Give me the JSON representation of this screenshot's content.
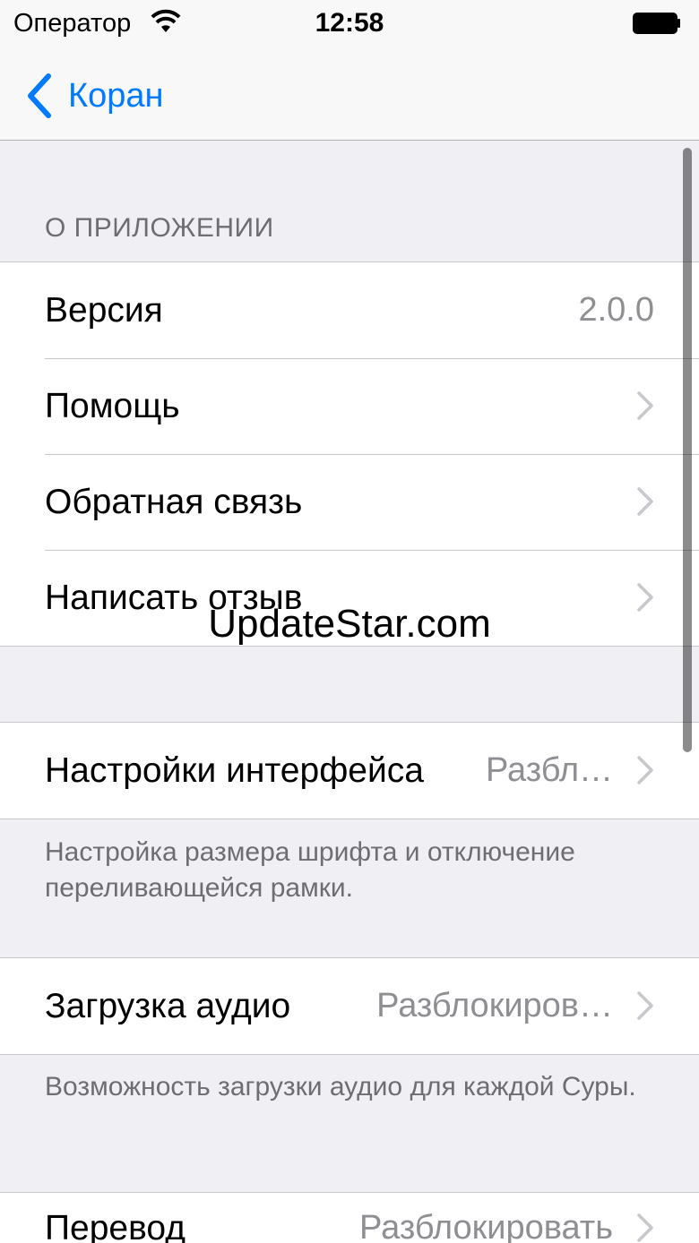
{
  "status_bar": {
    "carrier": "Оператор",
    "time": "12:58"
  },
  "nav": {
    "back_label": "Коран"
  },
  "sections": {
    "about_header": "О ПРИЛОЖЕНИИ",
    "about_rows": [
      {
        "label": "Версия",
        "value": "2.0.0"
      },
      {
        "label": "Помощь"
      },
      {
        "label": "Обратная связь"
      },
      {
        "label": "Написать отзыв"
      }
    ],
    "interface": {
      "label": "Настройки интерфейса",
      "value": "Разбл…"
    },
    "interface_footer": "Настройка размера шрифта и отключение переливающейся рамки.",
    "audio": {
      "label": "Загрузка аудио",
      "value": "Разблокиров…"
    },
    "audio_footer": "Возможность загрузки аудио для каждой Суры.",
    "translation": {
      "label": "Перевод",
      "value": "Разблокировать"
    }
  },
  "watermark": "UpdateStar.com",
  "colors": {
    "accent": "#007aff",
    "background": "#efeff4",
    "secondary_text": "#8e8e93"
  }
}
